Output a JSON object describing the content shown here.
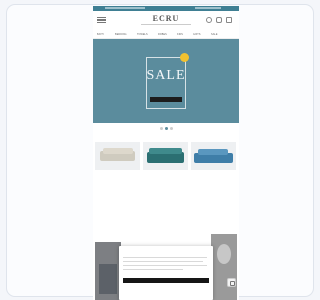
{
  "site": {
    "logo": "ECRU"
  },
  "nav": {
    "items": [
      "BATH",
      "BEDDING",
      "TOWELS",
      "ROBES",
      "KIDS",
      "GIFTS",
      "SALE"
    ]
  },
  "hero": {
    "badge": "",
    "eyebrow": "",
    "title": "SALE",
    "subtitle": "",
    "cta": ""
  },
  "carousel": {
    "slides": 3,
    "active_index": 1
  },
  "bestsellers": {
    "title": "",
    "subtitle": "",
    "view_all": "",
    "products": [
      {
        "name": "",
        "price": "",
        "color": "#cfcbbf"
      },
      {
        "name": "",
        "price": "",
        "color": "#2b6f72"
      },
      {
        "name": "",
        "price": "",
        "color": "#3f7ea8"
      }
    ]
  },
  "categories": {
    "eyebrow": "",
    "title": ""
  },
  "modal": {
    "title": "",
    "accept_label": "",
    "settings_label": ""
  },
  "colors": {
    "hero_background": "#5b8c9d",
    "status_bar": "#3f7f93",
    "badge": "#f2c230",
    "button": "#161616"
  },
  "icons": {
    "menu": "menu-icon",
    "search": "search-icon",
    "account": "account-icon",
    "cart": "cart-icon",
    "chat": "chat-icon"
  }
}
